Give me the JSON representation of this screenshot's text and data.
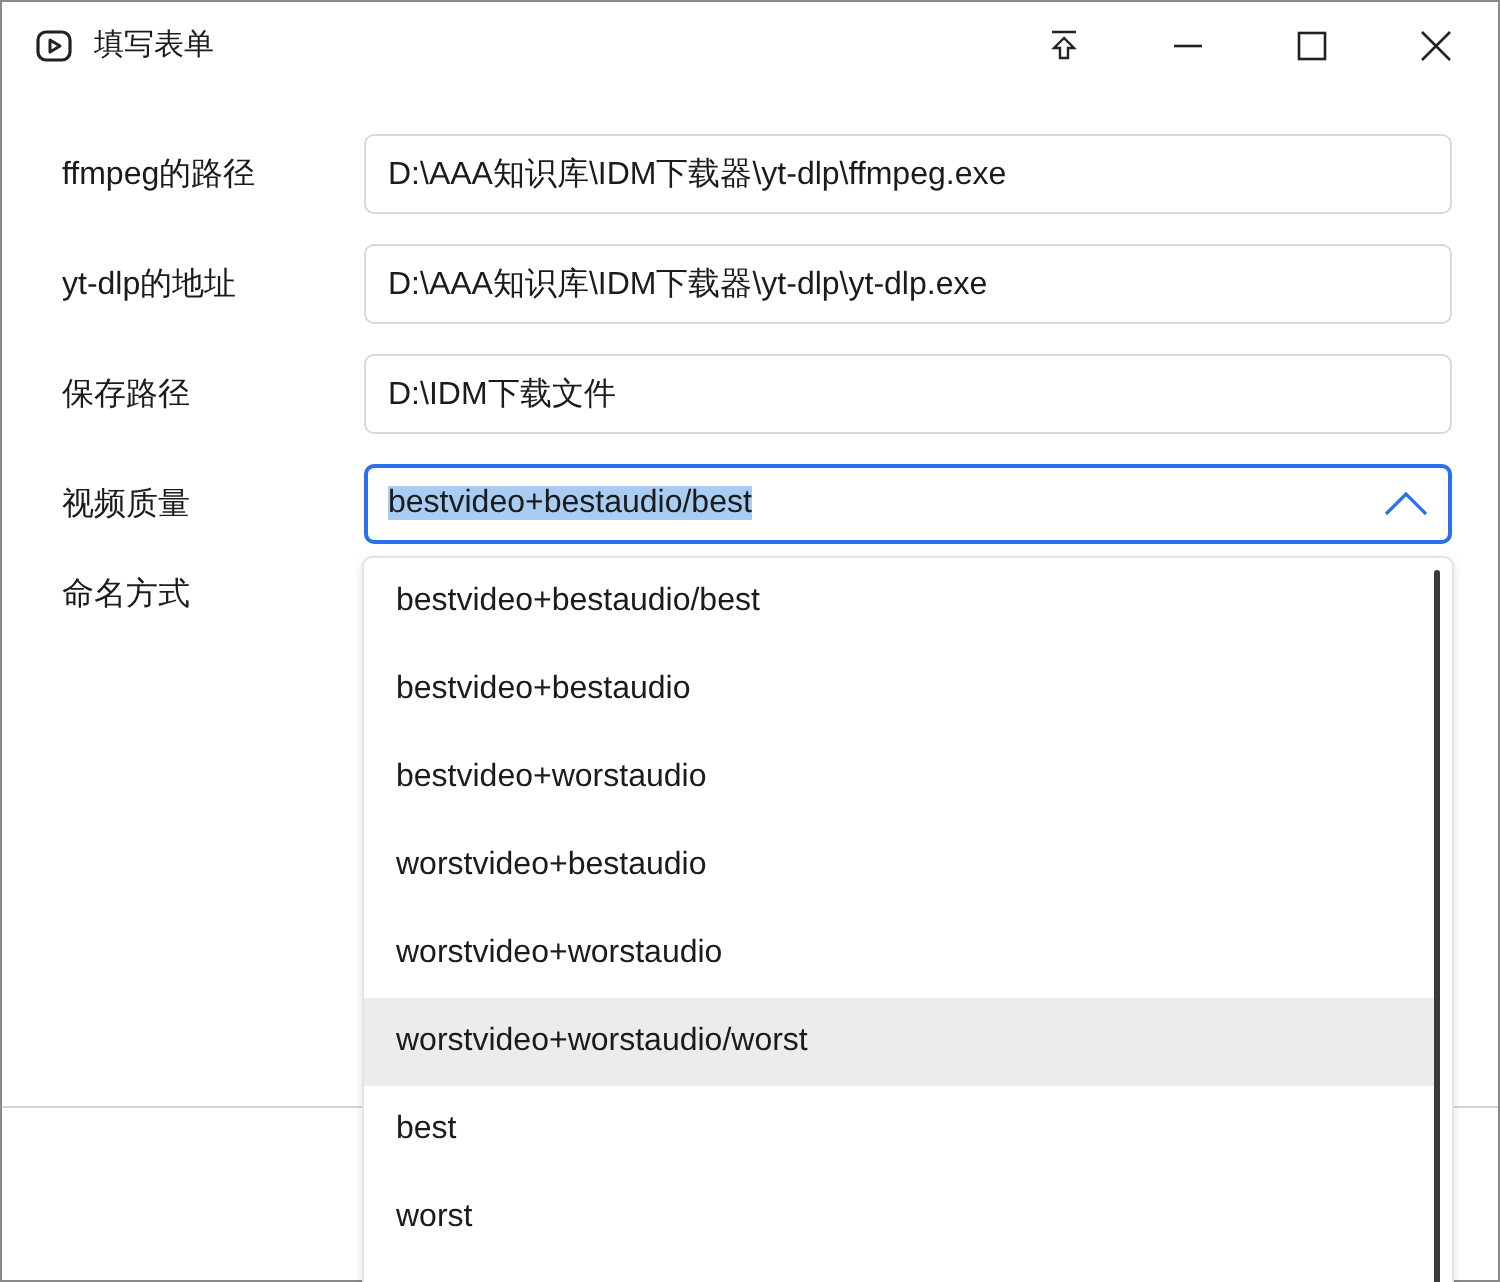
{
  "window": {
    "title": "填写表单"
  },
  "fields": [
    {
      "label": "ffmpeg的路径",
      "value": "D:\\AAA知识库\\IDM下载器\\yt-dlp\\ffmpeg.exe"
    },
    {
      "label": "yt-dlp的地址",
      "value": "D:\\AAA知识库\\IDM下载器\\yt-dlp\\yt-dlp.exe"
    },
    {
      "label": "保存路径",
      "value": "D:\\IDM下载文件"
    }
  ],
  "quality": {
    "label": "视频质量",
    "value": "bestvideo+bestaudio/best",
    "expanded": true,
    "options": [
      {
        "label": "bestvideo+bestaudio/best",
        "highlighted": false
      },
      {
        "label": "bestvideo+bestaudio",
        "highlighted": false
      },
      {
        "label": "bestvideo+worstaudio",
        "highlighted": false
      },
      {
        "label": "worstvideo+bestaudio",
        "highlighted": false
      },
      {
        "label": "worstvideo+worstaudio",
        "highlighted": false
      },
      {
        "label": "worstvideo+worstaudio/worst",
        "highlighted": true
      },
      {
        "label": "best",
        "highlighted": false
      },
      {
        "label": "worst",
        "highlighted": false
      }
    ]
  },
  "naming": {
    "label": "命名方式"
  }
}
